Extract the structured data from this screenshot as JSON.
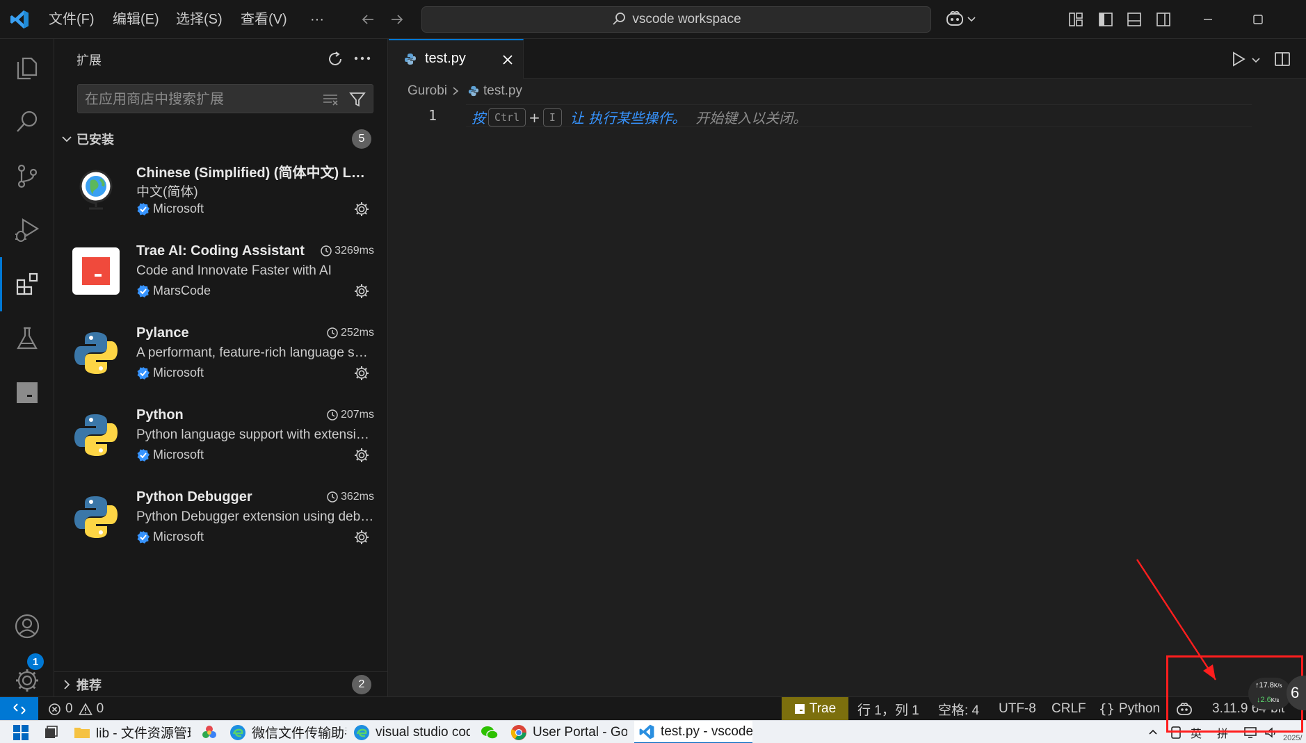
{
  "titlebar": {
    "menu": [
      "文件(F)",
      "编辑(E)",
      "选择(S)",
      "查看(V)",
      "···"
    ],
    "command_center": "vscode workspace"
  },
  "activitybar": {
    "items": [
      "explorer",
      "search",
      "source-control",
      "run-and-debug",
      "extensions",
      "testing",
      "trae"
    ],
    "accounts_badge": "1"
  },
  "sidebar": {
    "title": "扩展",
    "search_placeholder": "在应用商店中搜索扩展",
    "installed": {
      "label": "已安装",
      "count": "5",
      "items": [
        {
          "name": "Chinese (Simplified) (简体中文) Language Pack for Visual Studio Code",
          "description": "中文(简体)",
          "publisher": "Microsoft",
          "timing": ""
        },
        {
          "name": "Trae AI: Coding Assistant",
          "description": "Code and Innovate Faster with AI",
          "publisher": "MarsCode",
          "timing": "3269ms"
        },
        {
          "name": "Pylance",
          "description": "A performant, feature-rich language server for Python in VS Code",
          "publisher": "Microsoft",
          "timing": "252ms"
        },
        {
          "name": "Python",
          "description": "Python language support with extension access points for IntelliSense",
          "publisher": "Microsoft",
          "timing": "207ms"
        },
        {
          "name": "Python Debugger",
          "description": "Python Debugger extension using debugpy",
          "publisher": "Microsoft",
          "timing": "362ms"
        }
      ]
    },
    "recommended": {
      "label": "推荐",
      "count": "2"
    }
  },
  "editor": {
    "tab_label": "test.py",
    "breadcrumb": {
      "folder": "Gurobi",
      "file": "test.py"
    },
    "line_number": "1",
    "hint": {
      "press": "按",
      "key1": "Ctrl",
      "plus": "+",
      "key2": "I",
      "action": "让 执行某些操作。",
      "dismiss": "开始键入以关闭。"
    }
  },
  "statusbar": {
    "errors": "0",
    "warnings": "0",
    "trae": "Trae",
    "position": "行 1，列 1",
    "spaces": "空格: 4",
    "encoding": "UTF-8",
    "eol": "CRLF",
    "language": "Python",
    "interpreter": "3.11.9 64-bit"
  },
  "taskbar": {
    "items": [
      "lib - 文件资源管理器",
      "微信文件传输助手",
      "visual studio code",
      "User Portal - Google Chrome",
      "test.py - vscode workspace"
    ],
    "ime_lang": "英",
    "ime_mode": "拼",
    "date": "2025/"
  },
  "overlay": {
    "upload_speed": "↑17.8",
    "upload_unit": "K/s",
    "download_speed": "↓2.6",
    "download_unit": "K/s",
    "float_label": "6"
  },
  "colors": {
    "accent": "#0078d4",
    "trae_status": "#7c6f0d",
    "annotation": "#ff1e1e",
    "hint_blue": "#3794ff"
  }
}
